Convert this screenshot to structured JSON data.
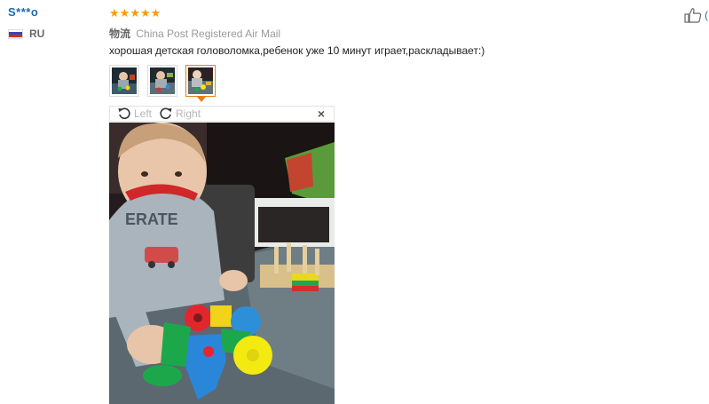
{
  "review": {
    "user_name": "S***o",
    "country_code": "RU",
    "rating": 5,
    "shipping_label": "物流",
    "shipping_method": "China Post Registered Air Mail",
    "text": "хорошая детская головоломка,ребенок уже 10 минут играет,раскладывает:)",
    "images": [
      "photo-1",
      "photo-2",
      "photo-3"
    ],
    "active_image": 3
  },
  "viewer": {
    "left_label": "Left",
    "right_label": "Right",
    "close_label": "×"
  },
  "like": {
    "count_text": "("
  },
  "colors": {
    "accent": "#e8801a",
    "star": "#ff9a00",
    "link": "#1a6ab4"
  },
  "icons": [
    "thumbs-up-icon",
    "rotate-left-icon",
    "rotate-right-icon",
    "close-icon",
    "star-icon",
    "russia-flag-icon"
  ]
}
